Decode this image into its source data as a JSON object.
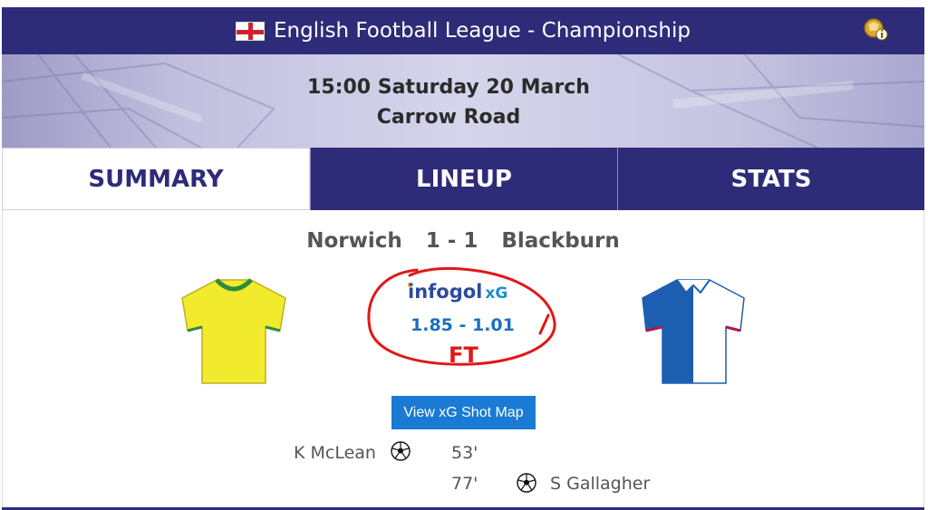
{
  "header": {
    "league_title": "English Football League - Championship",
    "flag_icon": "england-flag-icon",
    "info_icon": "football-info-icon"
  },
  "match_info": {
    "kickoff": "15:00 Saturday 20 March",
    "venue": "Carrow Road"
  },
  "tabs": [
    {
      "label": "SUMMARY",
      "active": true
    },
    {
      "label": "LINEUP",
      "active": false
    },
    {
      "label": "STATS",
      "active": false
    }
  ],
  "score": {
    "home_team": "Norwich",
    "result": "1 - 1",
    "away_team": "Blackburn"
  },
  "xg": {
    "brand": "infogol",
    "brand_suffix": "xG",
    "value": "1.85 - 1.01",
    "status": "FT"
  },
  "shotmap_button": {
    "label": "View xG Shot Map"
  },
  "events": [
    {
      "team": "home",
      "player": "K McLean",
      "minute": "53'"
    },
    {
      "team": "away",
      "player": "S Gallagher",
      "minute": "77'"
    }
  ],
  "colors": {
    "brand_navy": "#2e2b78",
    "home_kit": "#f2ea2c",
    "home_trim": "#2e8b3c",
    "away_kit_blue": "#1c5fb0",
    "away_trim": "#b0184a",
    "button_blue": "#1a7ad4",
    "annotation_red": "#e01818"
  }
}
